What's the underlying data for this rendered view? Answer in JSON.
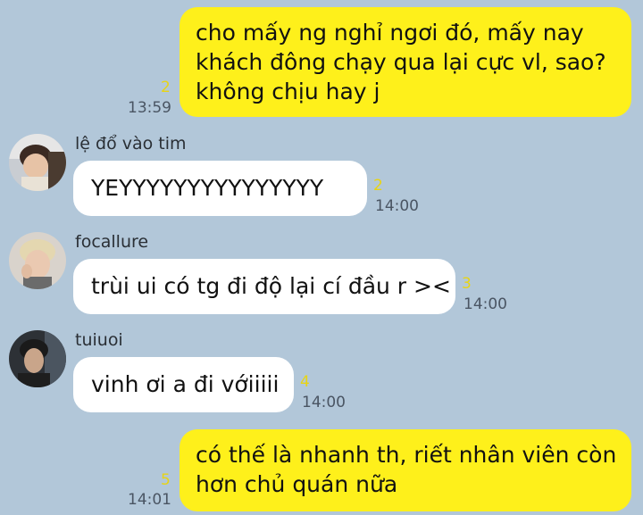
{
  "colors": {
    "background": "#b2c7d9",
    "outgoing_bubble": "#fef01b",
    "incoming_bubble": "#ffffff",
    "unread_count": "#e8d414",
    "timestamp": "#4a5563"
  },
  "messages": [
    {
      "direction": "outgoing",
      "lines": [
        "cho mấy ng nghỉ ngơi đó, mấy nay",
        "khách đông chạy qua lại cực vl, sao?",
        "không chịu hay j"
      ],
      "unread": "2",
      "time": "13:59"
    },
    {
      "direction": "incoming",
      "sender": "lệ đổ vào tim",
      "avatar_icon": "child-photo-avatar",
      "text": "YEYYYYYYYYYYYYYYY",
      "unread": "2",
      "time": "14:00"
    },
    {
      "direction": "incoming",
      "sender": "focallure",
      "avatar_icon": "blonde-person-photo-avatar",
      "text": "trùi ui có tg đi độ lại cí đầu r ><",
      "unread": "3",
      "time": "14:00"
    },
    {
      "direction": "incoming",
      "sender": "tuiuoi",
      "avatar_icon": "dark-haired-person-photo-avatar",
      "text": "vinh ơi a đi vớiiiii",
      "unread": "4",
      "time": "14:00"
    },
    {
      "direction": "outgoing",
      "lines": [
        "có thế là nhanh th, riết nhân viên còn",
        "hơn chủ quán nữa"
      ],
      "unread": "5",
      "time": "14:01"
    }
  ]
}
